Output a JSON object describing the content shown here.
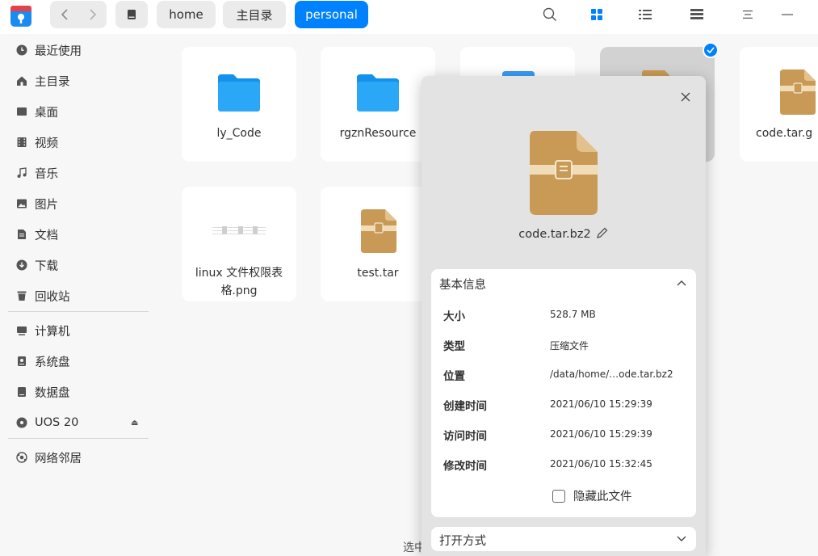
{
  "titlebar": {
    "breadcrumbs": [
      "home",
      "主目录",
      "personal"
    ],
    "active_crumb": "personal",
    "icons": [
      "app-logo-icon",
      "back-icon",
      "forward-icon",
      "disk-icon",
      "search-icon",
      "grid-view-icon",
      "list-view-icon",
      "tree-view-icon",
      "menu-icon",
      "minimize-icon"
    ]
  },
  "sidebar": {
    "items": [
      {
        "label": "最近使用",
        "icon": "clock-icon"
      },
      {
        "label": "主目录",
        "icon": "home-icon"
      },
      {
        "label": "桌面",
        "icon": "desktop-icon"
      },
      {
        "label": "视频",
        "icon": "video-icon"
      },
      {
        "label": "音乐",
        "icon": "music-icon"
      },
      {
        "label": "图片",
        "icon": "picture-icon"
      },
      {
        "label": "文档",
        "icon": "document-icon"
      },
      {
        "label": "下载",
        "icon": "download-icon"
      },
      {
        "label": "回收站",
        "icon": "trash-icon"
      }
    ],
    "devices": [
      {
        "label": "计算机",
        "icon": "computer-icon"
      },
      {
        "label": "系统盘",
        "icon": "system-disk-icon"
      },
      {
        "label": "数据盘",
        "icon": "data-disk-icon"
      },
      {
        "label": "UOS 20",
        "icon": "cd-icon",
        "eject": "⏏"
      }
    ],
    "network": [
      {
        "label": "网络邻居",
        "icon": "network-icon"
      }
    ]
  },
  "files": [
    {
      "name": "ly_Code",
      "type": "folder"
    },
    {
      "name": "rgznResource",
      "type": "folder"
    },
    {
      "name": "",
      "type": "folder"
    },
    {
      "name": "",
      "type": "archive",
      "selected": true
    },
    {
      "name": "code.tar.g",
      "type": "archive"
    },
    {
      "name": "linux 文件权限表格.png",
      "type": "image"
    },
    {
      "name": "test.tar",
      "type": "archive"
    }
  ],
  "status": {
    "text": "选中"
  },
  "properties": {
    "file_name": "code.tar.bz2",
    "section_title": "基本信息",
    "rows": [
      {
        "label": "大小",
        "value": "528.7 MB"
      },
      {
        "label": "类型",
        "value": "压缩文件"
      },
      {
        "label": "位置",
        "value": "/data/home/…ode.tar.bz2"
      },
      {
        "label": "创建时间",
        "value": "2021/06/10 15:29:39"
      },
      {
        "label": "访问时间",
        "value": "2021/06/10 15:29:39"
      },
      {
        "label": "修改时间",
        "value": "2021/06/10 15:32:45"
      }
    ],
    "hide_file_label": "隐藏此文件",
    "hide_file_checked": false,
    "open_with_label": "打开方式"
  },
  "colors": {
    "accent": "#0081ff",
    "archive": "#c99a55",
    "folder": "#1ea0f5"
  }
}
